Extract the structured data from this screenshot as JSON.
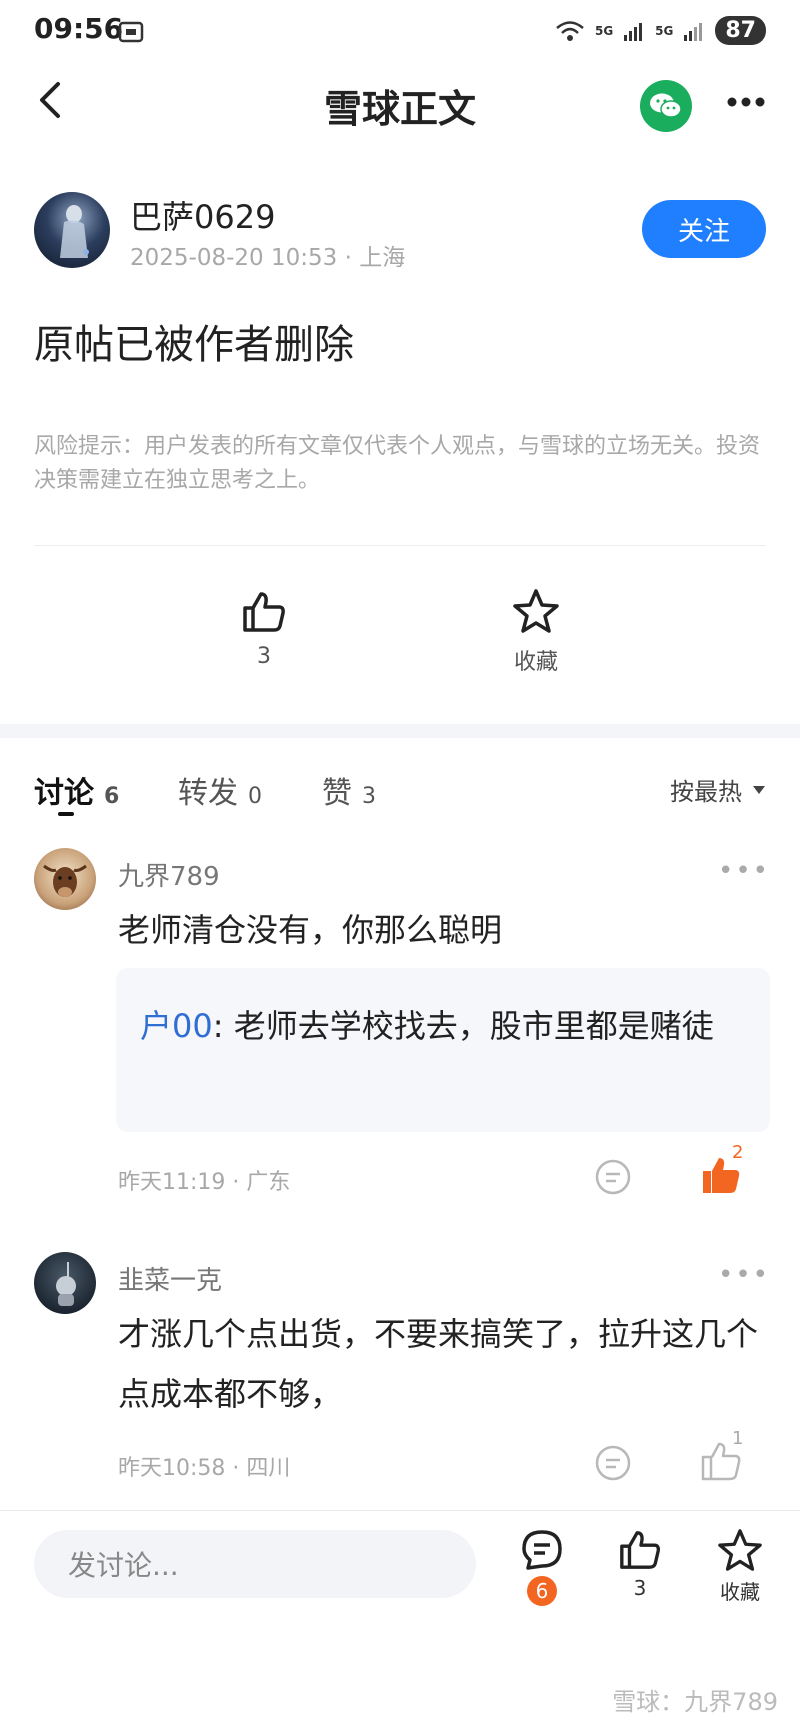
{
  "status": {
    "time": "09:56",
    "battery": "87",
    "sig1": "5G",
    "sig2": "5G"
  },
  "header": {
    "title": "雪球正文"
  },
  "author": {
    "name": "巴萨0629",
    "meta": "2025-08-20 10:53 · 上海",
    "follow": "关注"
  },
  "post": {
    "body": "原帖已被作者删除",
    "risk": "风险提示：用户发表的所有文章仅代表个人观点，与雪球的立场无关。投资决策需建立在独立思考之上。",
    "likes": "3",
    "collect": "收藏"
  },
  "tabs": [
    {
      "label": "讨论",
      "count": "6"
    },
    {
      "label": "转发",
      "count": "0"
    },
    {
      "label": "赞",
      "count": "3"
    }
  ],
  "sort": "按最热",
  "comments": [
    {
      "user": "九界789",
      "text": "老师清仓没有，你那么聪明",
      "reply_user": "户00",
      "reply_text": ": 老师去学校找去，股市里都是赌徒",
      "meta": "昨天11:19 · 广东",
      "likes": "2"
    },
    {
      "user": "韭菜一克",
      "text": "才涨几个点出货，不要来搞笑了，拉升这几个点成本都不够，",
      "meta": "昨天10:58 · 四川",
      "likes": "1"
    }
  ],
  "bottom": {
    "placeholder": "发讨论...",
    "comments": "6",
    "likes": "3",
    "collect": "收藏"
  },
  "watermark": "雪球：九界789",
  "colors": {
    "accent": "#1f7fff",
    "liked": "#f26622",
    "wechat": "#1aad5e"
  }
}
